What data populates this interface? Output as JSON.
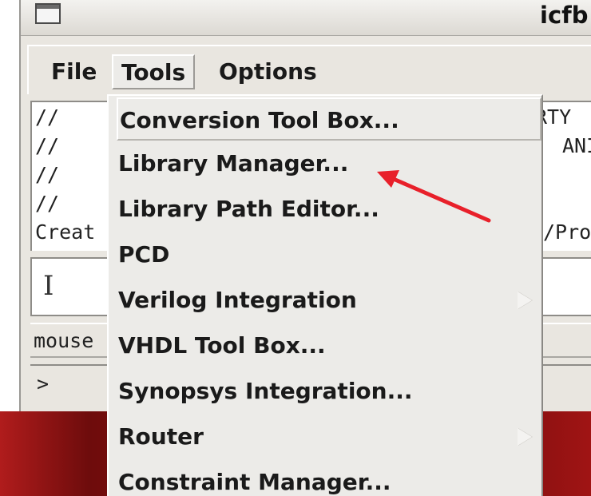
{
  "window": {
    "title": "icfb"
  },
  "menubar": {
    "file": "File",
    "tools": "Tools",
    "options": "Options"
  },
  "log": {
    "lines": [
      "//",
      "//",
      "//",
      "//",
      "Creat"
    ],
    "right_fragments": [
      "RTY",
      "ANI",
      "/Pro"
    ]
  },
  "input": {
    "cursor": "I"
  },
  "status": {
    "mouse": "mouse"
  },
  "prompt": {
    "symbol": ">"
  },
  "tools_menu": {
    "items": [
      {
        "label": "Conversion Tool Box...",
        "submenu": false
      },
      {
        "label": "Library Manager...",
        "submenu": false
      },
      {
        "label": "Library Path Editor...",
        "submenu": false
      },
      {
        "label": "PCD",
        "submenu": false
      },
      {
        "label": "Verilog Integration",
        "submenu": true
      },
      {
        "label": "VHDL Tool Box...",
        "submenu": false
      },
      {
        "label": "Synopsys Integration...",
        "submenu": false
      },
      {
        "label": "Router",
        "submenu": true
      },
      {
        "label": "Constraint Manager...",
        "submenu": false
      }
    ]
  },
  "annotation": {
    "arrow_color": "#e8202a",
    "target": "Library Manager..."
  },
  "colors": {
    "window_bg": "#e9e6e0",
    "desktop": "#8e1414"
  }
}
